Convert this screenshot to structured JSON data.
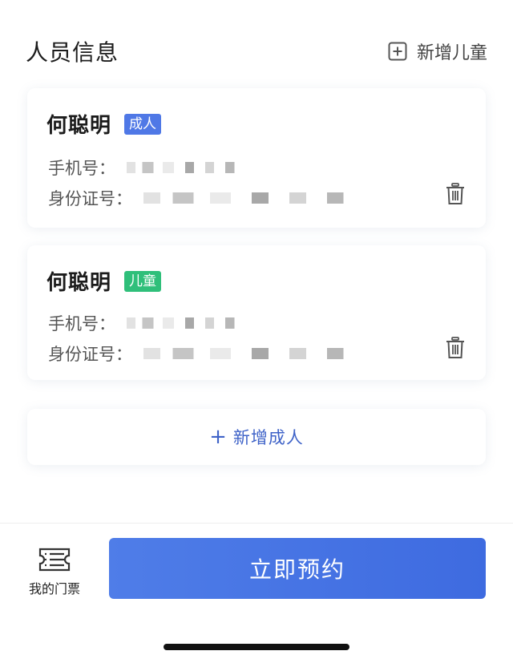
{
  "header": {
    "title": "人员信息",
    "add_child_label": "新增儿童"
  },
  "persons": [
    {
      "name": "何聪明",
      "tag": "成人",
      "phone_label": "手机号：",
      "id_label": "身份证号：",
      "tag_color": "#4f78e6"
    },
    {
      "name": "何聪明",
      "tag": "儿童",
      "phone_label": "手机号：",
      "id_label": "身份证号：",
      "tag_color": "#2fbf7a"
    }
  ],
  "add_adult_label": "新增成人",
  "bottom": {
    "my_tickets_label": "我的门票",
    "book_label": "立即预约"
  },
  "colors": {
    "accent": "#3e6be0",
    "link": "#3f63c8"
  },
  "icons": {
    "add_child": "plus-square-icon",
    "delete": "trash-icon",
    "my_tickets": "ticket-list-icon",
    "add_adult": "plus-icon"
  }
}
